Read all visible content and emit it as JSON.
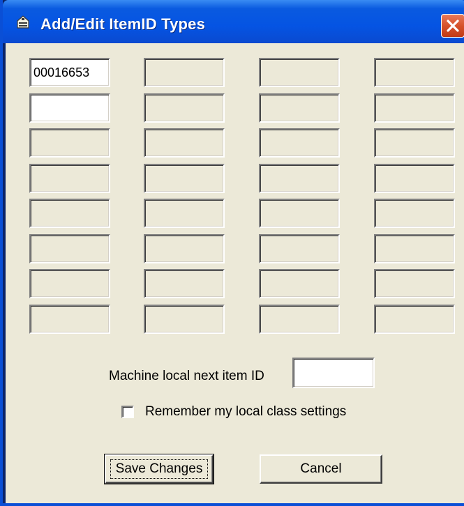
{
  "window": {
    "title": "Add/Edit ItemID Types",
    "title_icon": "itemid-app-icon",
    "close_icon": "close-icon"
  },
  "grid": {
    "fields": [
      [
        "00016653",
        "",
        "",
        ""
      ],
      [
        "",
        "",
        "",
        ""
      ],
      [
        "",
        "",
        "",
        ""
      ],
      [
        "",
        "",
        "",
        ""
      ],
      [
        "",
        "",
        "",
        ""
      ],
      [
        "",
        "",
        "",
        ""
      ],
      [
        "",
        "",
        "",
        ""
      ],
      [
        "",
        "",
        "",
        ""
      ]
    ]
  },
  "next_item": {
    "label": "Machine local next item ID",
    "value": ""
  },
  "remember": {
    "label": "Remember my local class settings",
    "checked": false
  },
  "buttons": {
    "save_label": "Save Changes",
    "cancel_label": "Cancel"
  },
  "colors": {
    "titlebar": "#0554e3",
    "dialog_face": "#ece9d8",
    "close_button": "#d6522b"
  }
}
